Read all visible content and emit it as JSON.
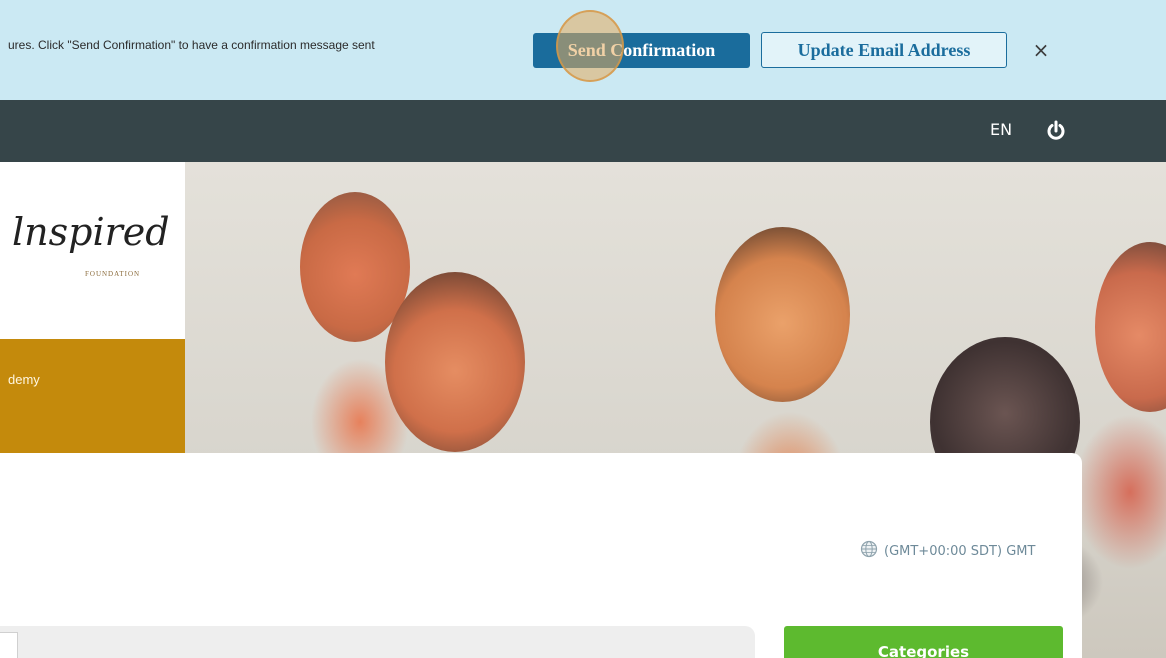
{
  "banner": {
    "message": "ures. Click \"Send Confirmation\" to have a confirmation message sent",
    "send_label": "Send Confirmation",
    "update_label": "Update Email Address",
    "close_glyph": "×"
  },
  "header": {
    "language": "EN",
    "power_icon": "power-icon"
  },
  "hero": {
    "logo_text": "lnspired",
    "logo_sub": "FOUNDATION",
    "academy_text": "demy"
  },
  "main": {
    "timezone": "(GMT+00:00 SDT) GMT",
    "timezone_icon": "globe-icon",
    "categories_label": "Categories"
  },
  "colors": {
    "banner_bg": "#cbe9f3",
    "send_button": "#1a6c9c",
    "navbar": "#364549",
    "academy_gold": "#c48a0c",
    "categories_green": "#5dba2f"
  }
}
